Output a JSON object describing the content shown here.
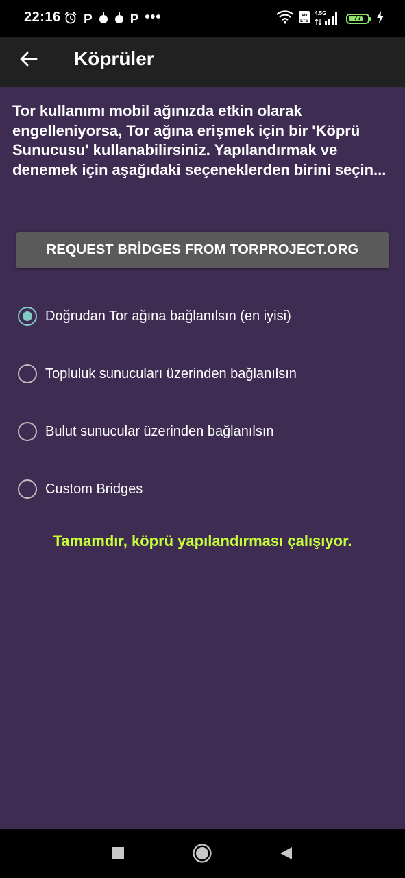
{
  "status_bar": {
    "time": "22:16",
    "left_icons": [
      "alarm-icon",
      "p-icon",
      "drop-icon",
      "drop-icon",
      "p-icon",
      "more-icon"
    ],
    "p_letter": "P",
    "more": "•••",
    "network_label": "4.5G",
    "volte_label": "Vo LTE",
    "battery_level": "77",
    "battery_percent": 77,
    "battery_color": "#8fe36b"
  },
  "app_bar": {
    "title": "Köprüler",
    "back_icon": "arrow-back-icon"
  },
  "intro_text": "Tor kullanımı mobil ağınızda etkin olarak engelleniyorsa, Tor ağına erişmek için bir 'Köprü Sunucusu' kullanabilirsiniz. Yapılandırmak ve denemek için aşağıdaki seçeneklerden birini seçin...",
  "request_button_label": "REQUEST BRİDGES FROM TORPROJECT.ORG",
  "options": [
    {
      "label": "Doğrudan Tor ağına bağlanılsın (en iyisi)",
      "checked": true
    },
    {
      "label": "Topluluk sunucuları üzerinden bağlanılsın",
      "checked": false
    },
    {
      "label": "Bulut sunucular üzerinden bağlanılsın",
      "checked": false
    },
    {
      "label": "Custom Bridges",
      "checked": false
    }
  ],
  "status_message": "Tamamdır, köprü yapılandırması çalışıyor.",
  "colors": {
    "background": "#3f2c52",
    "app_bar": "#212121",
    "accent_radio": "#80cbc4",
    "status_message": "#c6ff3a",
    "button": "#5a5a5a"
  },
  "nav_bar": {
    "icons": [
      "recents-square-icon",
      "home-circle-icon",
      "back-triangle-icon"
    ]
  }
}
